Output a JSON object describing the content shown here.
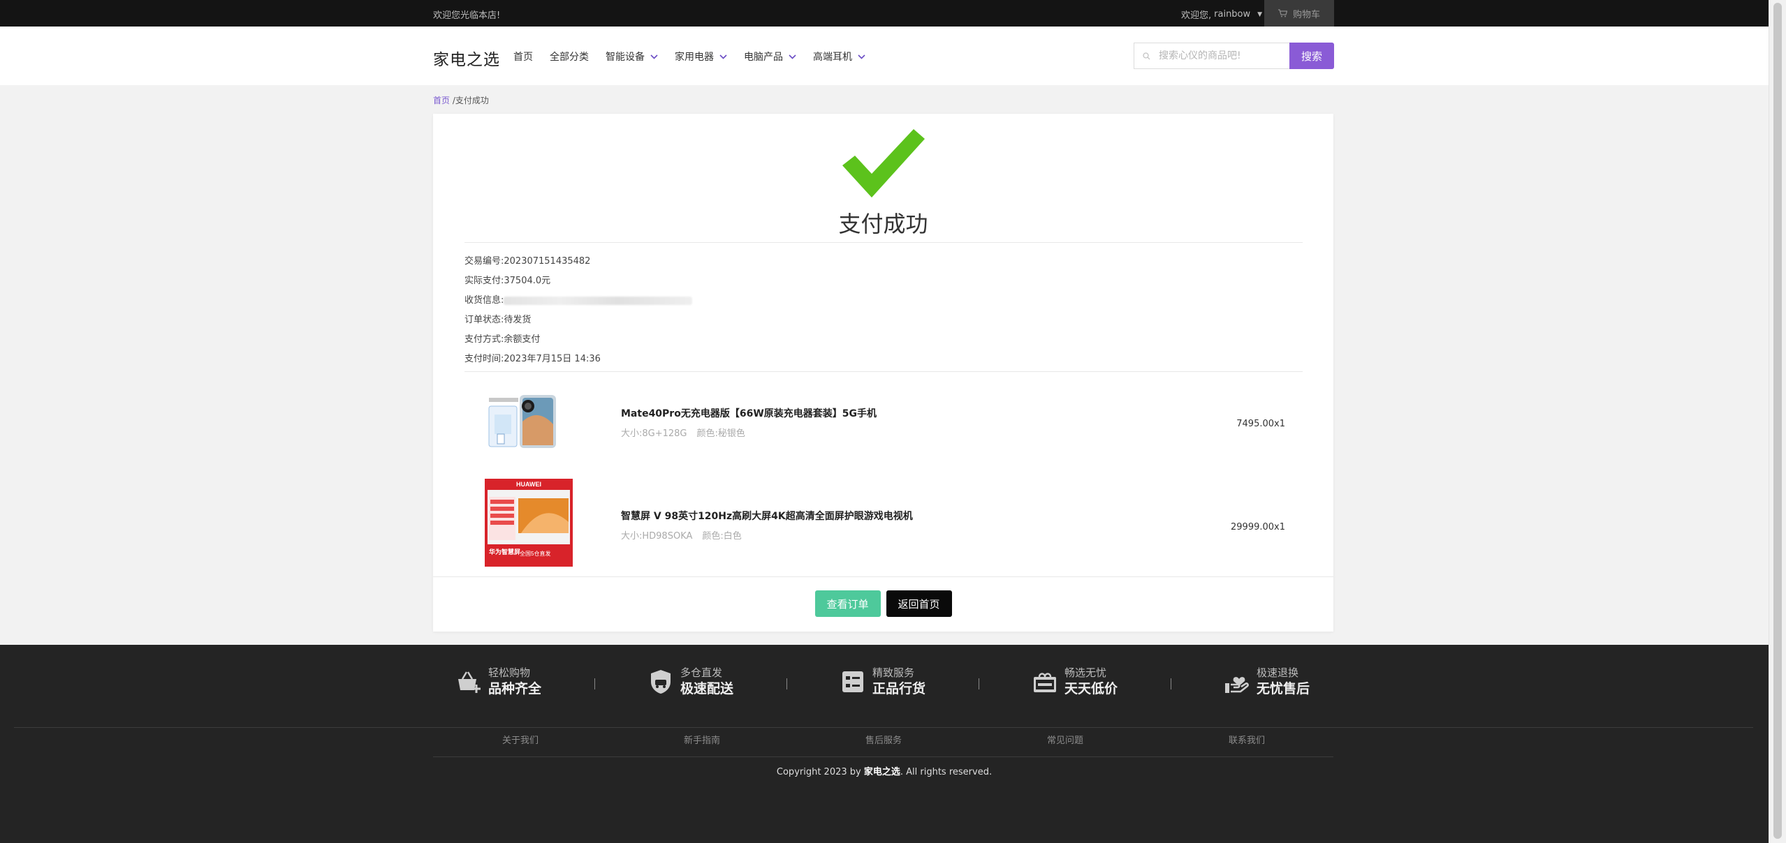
{
  "topbar": {
    "welcome_text": "欢迎您光临本店!",
    "user_greeting": "欢迎您,",
    "username": "rainbow",
    "cart_label": "购物车"
  },
  "header": {
    "logo": "家电之选",
    "nav": [
      {
        "label": "首页",
        "has_dropdown": false
      },
      {
        "label": "全部分类",
        "has_dropdown": false
      },
      {
        "label": "智能设备",
        "has_dropdown": true
      },
      {
        "label": "家用电器",
        "has_dropdown": true
      },
      {
        "label": "电脑产品",
        "has_dropdown": true
      },
      {
        "label": "高端耳机",
        "has_dropdown": true
      }
    ],
    "search_placeholder": "搜索心仪的商品吧!",
    "search_button": "搜索"
  },
  "breadcrumb": {
    "home": "首页",
    "current": "/支付成功"
  },
  "success": {
    "title": "支付成功"
  },
  "order_info": {
    "trade_no_label": "交易编号:",
    "trade_no": "202307151435482",
    "paid_label": "实际支付:",
    "paid": "37504.0元",
    "address_label": "收货信息:",
    "status_label": "订单状态:",
    "status": "待发货",
    "method_label": "支付方式:",
    "method": "余额支付",
    "time_label": "支付时间:",
    "time": "2023年7月15日 14:36"
  },
  "items": [
    {
      "name": "Mate40Pro无充电器版【66W原装充电器套装】5G手机",
      "size": "大小:8G+128G",
      "color": "颜色:秘银色",
      "price": "7495.00x1"
    },
    {
      "name": "智慧屏 V 98英寸120Hz高刷大屏4K超高清全面屏护眼游戏电视机",
      "size": "大小:HD98SOKA",
      "color": "颜色:白色",
      "price": "29999.00x1",
      "thumb_brand": "HUAWEI",
      "thumb_tag": "华为智慧屏",
      "thumb_caption": "全国5仓直发"
    }
  ],
  "actions": {
    "view_order": "查看订单",
    "back_home": "返回首页"
  },
  "footer": {
    "features": [
      {
        "small": "轻松购物",
        "big": "品种齐全",
        "icon": "basket-icon"
      },
      {
        "small": "多仓直发",
        "big": "极速配送",
        "icon": "shield-car-icon"
      },
      {
        "small": "精致服务",
        "big": "正品行货",
        "icon": "list-icon"
      },
      {
        "small": "畅选无忧",
        "big": "天天低价",
        "icon": "gift-box-icon"
      },
      {
        "small": "极速退换",
        "big": "无忧售后",
        "icon": "heart-hand-icon"
      }
    ],
    "links": [
      "关于我们",
      "新手指南",
      "售后服务",
      "常见问题",
      "联系我们"
    ],
    "copyright_prefix": "Copyright 2023 by ",
    "copyright_brand": "家电之选",
    "copyright_suffix": ". All rights reserved."
  },
  "colors": {
    "accent": "#8a5bd6",
    "success_check": "#5cc21c",
    "view_button": "#4ec99b"
  }
}
